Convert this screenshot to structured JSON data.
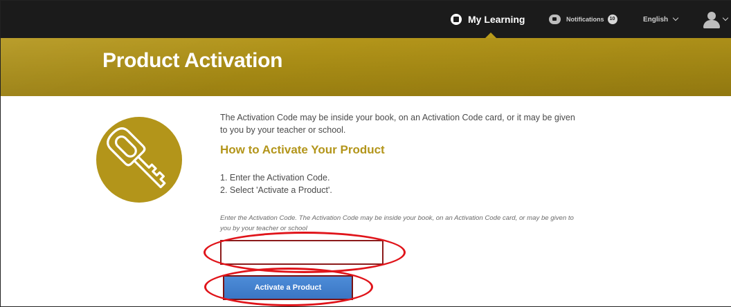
{
  "nav": {
    "my_learning": "My Learning",
    "notifications": "Notifications",
    "notifications_count": "10",
    "language": "English"
  },
  "header": {
    "title": "Product Activation"
  },
  "main": {
    "intro": "The Activation Code may be inside your book, on an Activation Code card, or it may be given to you by your teacher or school.",
    "how_title": "How to Activate Your Product",
    "steps": [
      "1.  Enter the Activation Code.",
      "2.  Select 'Activate a Product'."
    ],
    "hint": "Enter the Activation Code. The Activation Code may be inside your book, on an Activation Code card, or may be given to you by your teacher or school",
    "code_input_value": "",
    "activate_label": "Activate a Product"
  },
  "colors": {
    "topbar": "#1b1b1b",
    "gold": "#b3951a",
    "button_blue": "#3a76c4",
    "annotation_red": "#e0141a"
  },
  "icons": [
    "my-learning-icon",
    "notifications-icon",
    "chevron-down-icon",
    "avatar-icon",
    "key-icon"
  ]
}
